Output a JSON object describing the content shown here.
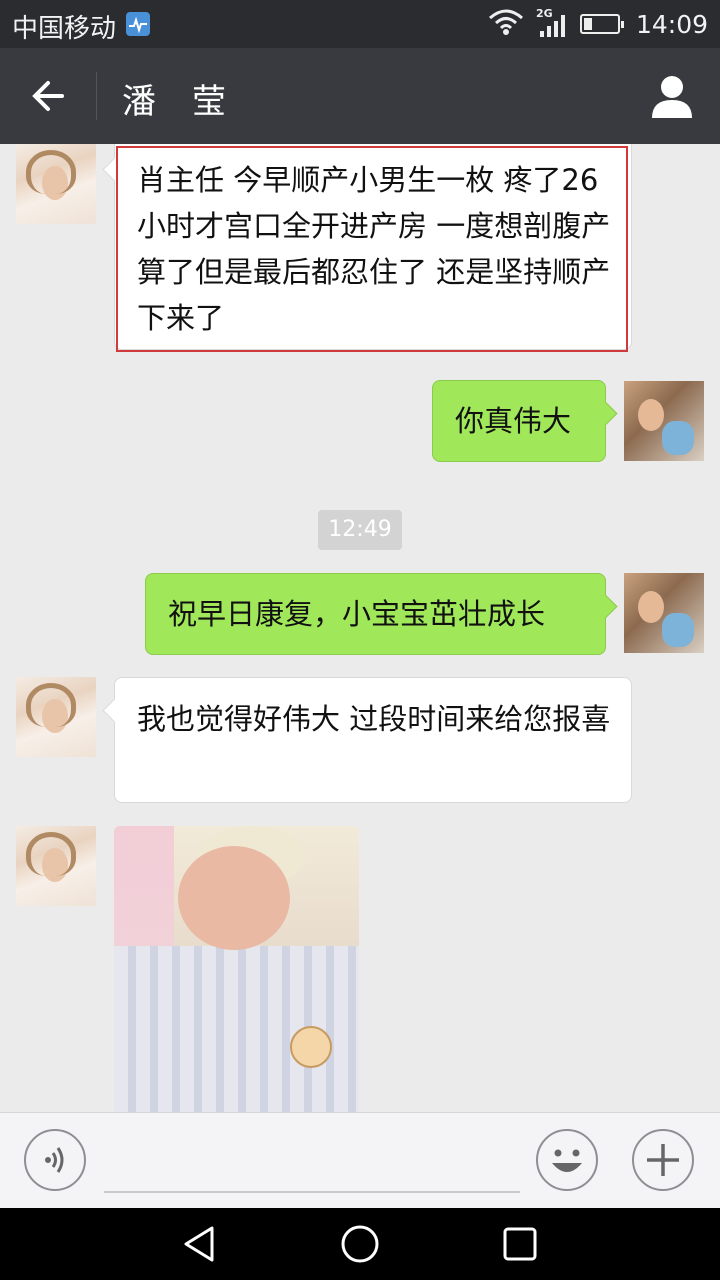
{
  "status_bar": {
    "carrier": "中国移动",
    "network": "2G",
    "time": "14:09"
  },
  "header": {
    "title_first": "潘",
    "title_last": "莹"
  },
  "messages": [
    {
      "side": "left",
      "type": "text",
      "text": "肖主任 今早顺产小男生一枚 疼了26小时才宫口全开进产房 一度想剖腹产算了但是最后都忍住了 还是坚持顺产下来了",
      "highlighted": true
    },
    {
      "side": "right",
      "type": "text",
      "text": "你真伟大"
    },
    {
      "type": "timestamp",
      "text": "12:49"
    },
    {
      "side": "right",
      "type": "text",
      "text": "祝早日康复，小宝宝茁壮成长"
    },
    {
      "side": "left",
      "type": "text",
      "text": "我也觉得好伟大 过段时间来给您报喜"
    },
    {
      "side": "left",
      "type": "image"
    }
  ],
  "input_bar": {
    "icons": [
      "voice-icon",
      "emoji-icon",
      "plus-icon"
    ]
  },
  "colors": {
    "titlebar": "#393a3f",
    "statusbar": "#2b2c30",
    "chat_bg": "#ebebeb",
    "bubble_sent": "#a0e75a",
    "bubble_received": "#ffffff",
    "highlight_border": "#d03a3a"
  }
}
